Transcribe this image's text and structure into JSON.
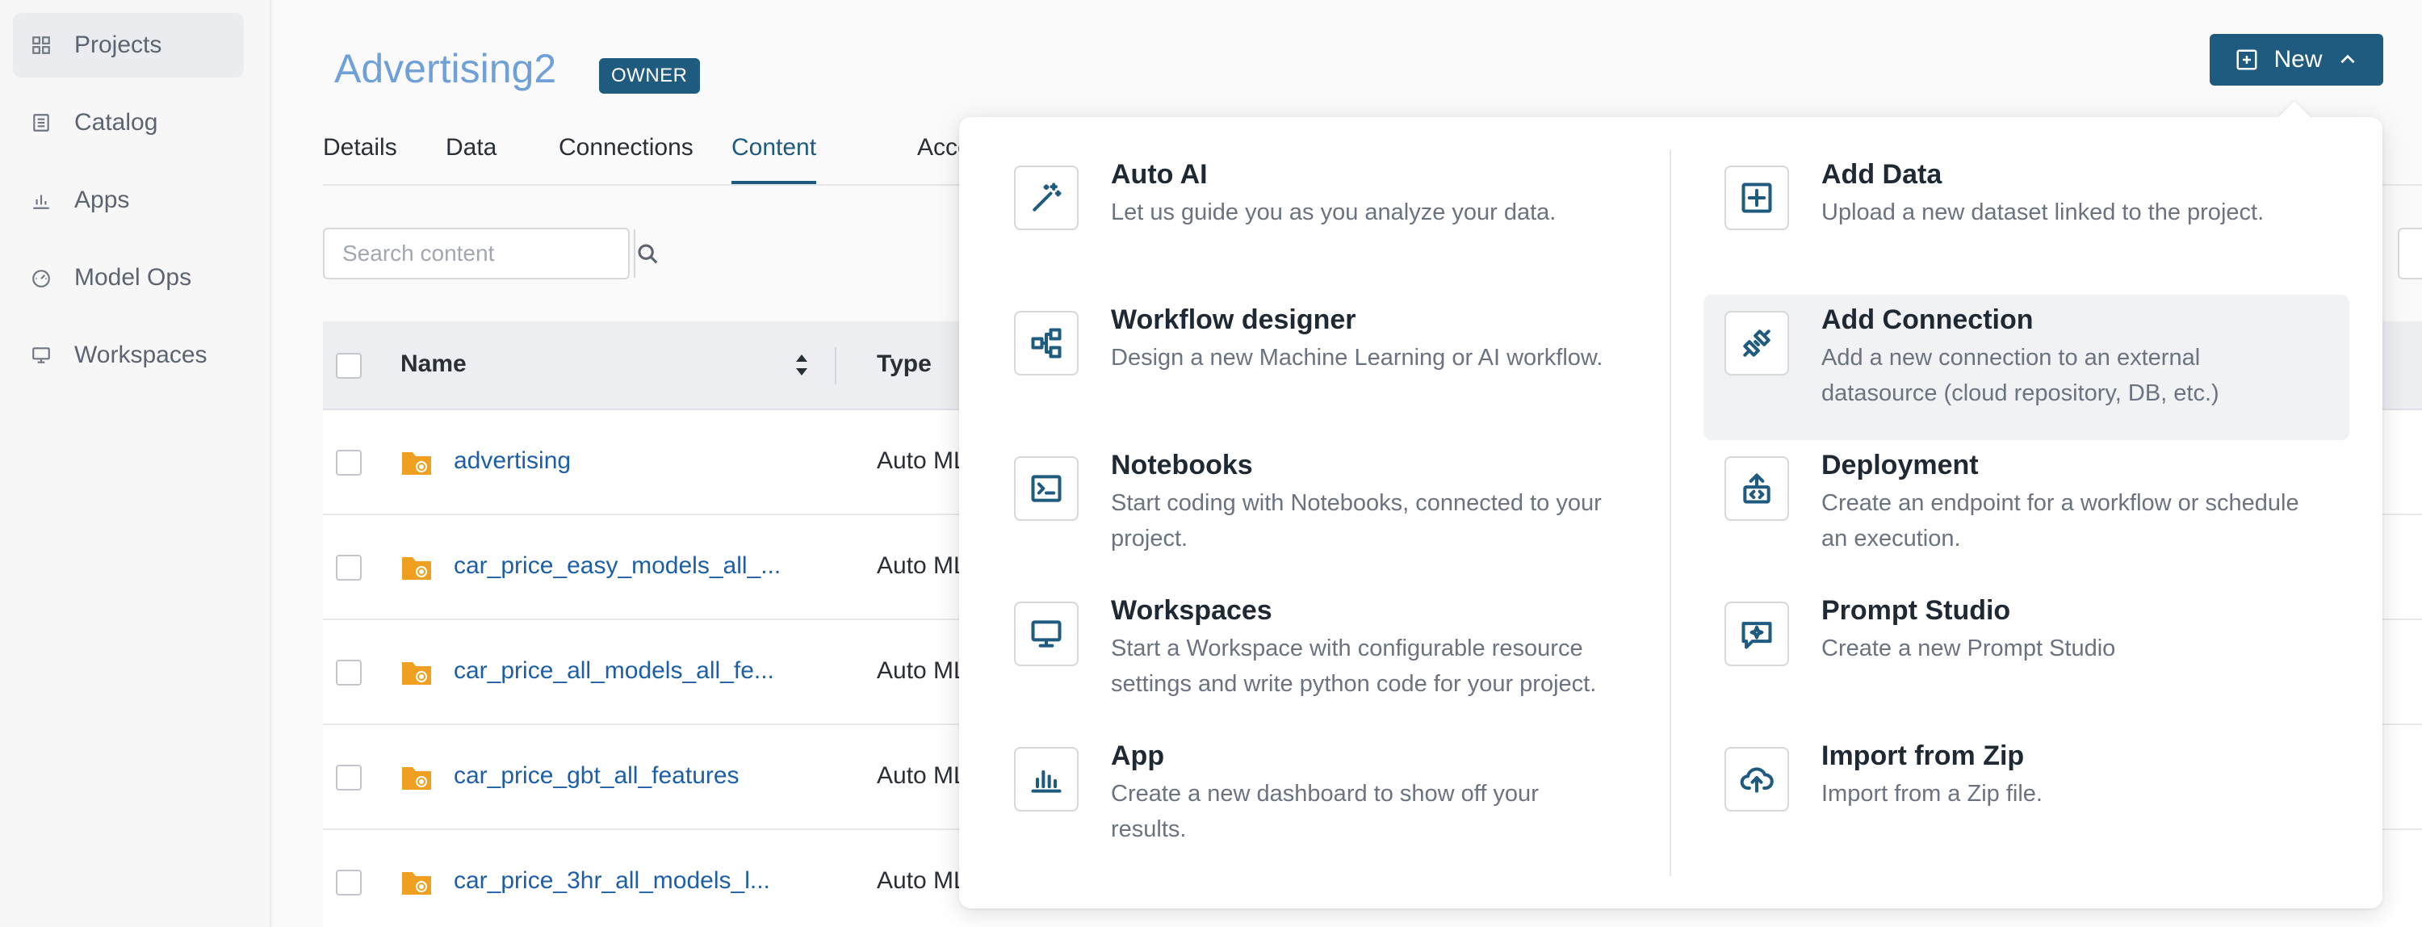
{
  "sidebar": {
    "items": [
      {
        "label": "Projects",
        "icon": "grid-icon",
        "active": true
      },
      {
        "label": "Catalog",
        "icon": "book-icon",
        "active": false
      },
      {
        "label": "Apps",
        "icon": "bar-chart-icon",
        "active": false
      },
      {
        "label": "Model Ops",
        "icon": "gauge-icon",
        "active": false
      },
      {
        "label": "Workspaces",
        "icon": "monitor-icon",
        "active": false
      }
    ]
  },
  "project": {
    "title": "Advertising2",
    "badge": "OWNER"
  },
  "tabs": [
    {
      "label": "Details"
    },
    {
      "label": "Data"
    },
    {
      "label": "Connections"
    },
    {
      "label": "Content",
      "active": true
    },
    {
      "label": "Access"
    }
  ],
  "search": {
    "placeholder": "Search content"
  },
  "table": {
    "headers": {
      "name": "Name",
      "type": "Type"
    },
    "rows": [
      {
        "name": "advertising",
        "type": "Auto ML"
      },
      {
        "name": "car_price_easy_models_all_...",
        "type": "Auto ML"
      },
      {
        "name": "car_price_all_models_all_fe...",
        "type": "Auto ML"
      },
      {
        "name": "car_price_gbt_all_features",
        "type": "Auto ML"
      },
      {
        "name": "car_price_3hr_all_models_l...",
        "type": "Auto ML"
      }
    ]
  },
  "new_button": {
    "label": "New"
  },
  "menu": {
    "left": [
      {
        "title": "Auto AI",
        "desc": "Let us guide you as you analyze your data.",
        "icon": "magic-wand-icon"
      },
      {
        "title": "Workflow designer",
        "desc": "Design a new Machine Learning or AI workflow.",
        "icon": "workflow-icon"
      },
      {
        "title": "Notebooks",
        "desc": "Start coding with Notebooks, connected to your project.",
        "icon": "terminal-icon"
      },
      {
        "title": "Workspaces",
        "desc": "Start a Workspace with configurable resource settings and write python code for your project.",
        "icon": "monitor-icon"
      },
      {
        "title": "App",
        "desc": "Create a new dashboard to show off your results.",
        "icon": "bar-chart-icon"
      }
    ],
    "right": [
      {
        "title": "Add Data",
        "desc": "Upload a new dataset linked to the project.",
        "icon": "add-square-icon"
      },
      {
        "title": "Add Connection",
        "desc": "Add a new connection to an external datasource (cloud repository, DB, etc.)",
        "icon": "plug-icon",
        "hover": true
      },
      {
        "title": "Deployment",
        "desc": "Create an endpoint for a workflow or schedule an execution.",
        "icon": "deploy-icon"
      },
      {
        "title": "Prompt Studio",
        "desc": "Create a new Prompt Studio",
        "icon": "sparkle-chat-icon"
      },
      {
        "title": "Import from Zip",
        "desc": "Import from a Zip file.",
        "icon": "cloud-upload-icon"
      }
    ]
  },
  "colors": {
    "primary": "#1f5a7f",
    "link": "#1d5fa6",
    "title": "#6fa0d8",
    "folder": "#f0a020"
  }
}
